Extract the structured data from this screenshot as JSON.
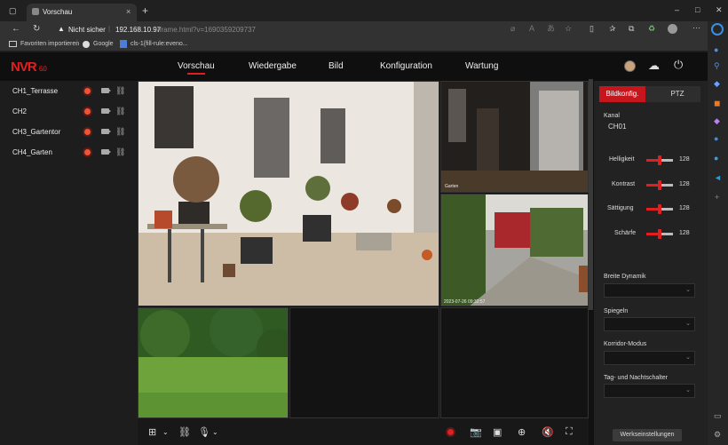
{
  "browser": {
    "tab_title": "Vorschau",
    "security_label": "Nicht sicher",
    "url_host": "192.168.10.97",
    "url_path": "/frame.html?v=1690359209737",
    "favorites": [
      "Favoriten importieren",
      "Google",
      "cls-1{fill-rule:eveno..."
    ],
    "window_controls": [
      "–",
      "□",
      "✕"
    ]
  },
  "nvr": {
    "logo": "NVR",
    "logo_version": "6.0",
    "nav": [
      {
        "label": "Vorschau",
        "active": true
      },
      {
        "label": "Wiedergabe",
        "active": false
      },
      {
        "label": "Bild",
        "active": false
      },
      {
        "label": "Konfiguration",
        "active": false
      },
      {
        "label": "Wartung",
        "active": false
      }
    ],
    "channels": [
      {
        "label": "CH1_Terrasse"
      },
      {
        "label": "CH2"
      },
      {
        "label": "CH3_Gartentor"
      },
      {
        "label": "CH4_Garten"
      }
    ],
    "tile_overlays": {
      "ch2_name": "Garten",
      "ch3_timestamp": "2023-07-26 09:32:57"
    },
    "panel": {
      "tabs": [
        {
          "label": "Bildkonfig.",
          "active": true
        },
        {
          "label": "PTZ",
          "active": false
        }
      ],
      "kanal_label": "Kanal",
      "kanal_value": "CH01",
      "sliders": [
        {
          "label": "Helligkeit",
          "value": 128,
          "max": 255
        },
        {
          "label": "Kontrast",
          "value": 128,
          "max": 255
        },
        {
          "label": "Sättigung",
          "value": 128,
          "max": 255
        },
        {
          "label": "Schärfe",
          "value": 128,
          "max": 255
        }
      ],
      "dropdowns": [
        {
          "label": "Breite Dynamik",
          "value": ""
        },
        {
          "label": "Spiegeln",
          "value": ""
        },
        {
          "label": "Korridor-Modus",
          "value": ""
        },
        {
          "label": "Tag- und Nachtschalter",
          "value": ""
        }
      ],
      "reset_label": "Werkseinstellungen"
    },
    "colors": {
      "accent": "#e02020",
      "active_tab": "#c4161c"
    }
  }
}
